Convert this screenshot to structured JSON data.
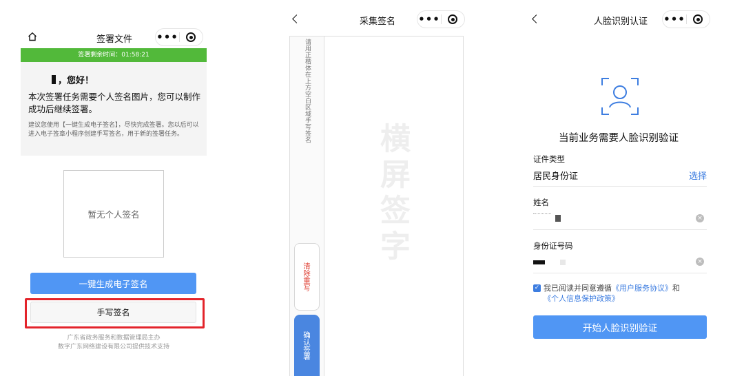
{
  "screen_sign": {
    "nav_title": "签署文件",
    "timer_text": "签署剩余时间：01:58:21",
    "greeting": "，您好！",
    "notice_main": "本次签署任务需要个人签名图片，您可以制作成功后继续签署。",
    "notice_sub": "建议您使用【一键生成电子签名】，尽快完成签署。您以后可以进入电子签章小程序创建手写签名，用于新的签署任务。",
    "signature_placeholder": "暂无个人签名",
    "generate_button": "一键生成电子签名",
    "handwrite_button": "手写签名",
    "footer_line1": "广东省政务服务和数据管理局主办",
    "footer_line2": "数字广东网络建设有限公司提供技术支持",
    "colors": {
      "timer_bar": "#52b93a",
      "primary": "#5096f4",
      "highlight": "#e3242b"
    }
  },
  "screen_collect": {
    "nav_title": "采集签名",
    "hint": "请用正楷体在上方空白区域手写签名",
    "watermark": "横屏签字",
    "clear_button": "清除重写",
    "confirm_button": "确认签署"
  },
  "screen_face": {
    "nav_title": "人脸识别认证",
    "title": "当前业务需要人脸识别验证",
    "id_type_label": "证件类型",
    "id_type_value": "居民身份证",
    "choose_link": "选择",
    "name_label": "姓名",
    "id_number_label": "身份证号码",
    "agree_prefix": "我已阅读并同意遵循",
    "agree_link1": "《用户服务协议》",
    "agree_and": "和",
    "agree_link2": "《个人信息保护政策》",
    "start_button": "开始人脸识别验证"
  }
}
